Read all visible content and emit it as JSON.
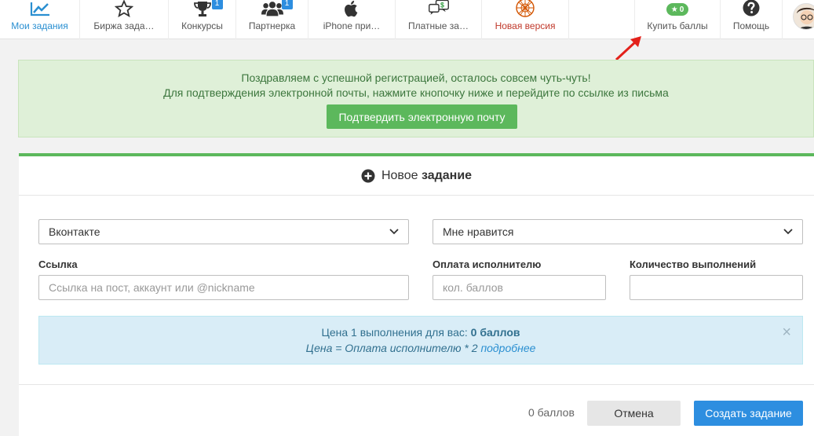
{
  "nav": {
    "items": [
      {
        "label": "Мои задания",
        "icon": "chart-line-icon"
      },
      {
        "label": "Биржа зада…",
        "icon": "star-icon"
      },
      {
        "label": "Конкурсы",
        "icon": "trophy-icon",
        "badge": "1"
      },
      {
        "label": "Партнерка",
        "icon": "users-icon",
        "badge": "1"
      },
      {
        "label": "iPhone при…",
        "icon": "apple-icon"
      },
      {
        "label": "Платные за…",
        "icon": "money-chat-icon"
      },
      {
        "label": "Новая версия",
        "icon": "globe-icon"
      },
      {
        "label": "Купить баллы",
        "icon": "star-pill-icon",
        "points": "0"
      },
      {
        "label": "Помощь",
        "icon": "help-icon"
      }
    ]
  },
  "success_alert": {
    "line1": "Поздравляем с успешной регистрацией, осталось совсем чуть-чуть!",
    "line2": "Для подтверждения электронной почты, нажмите кнопочку ниже и перейдите по ссылке из письма",
    "button": "Подтвердить электронную почту"
  },
  "form": {
    "title_prefix": "Новое",
    "title_bold": "задание",
    "network_select": "Вконтакте",
    "action_select": "Мне нравится",
    "link_label": "Ссылка",
    "link_placeholder": "Ссылка на пост, аккаунт или @nickname",
    "pay_label": "Оплата исполнителю",
    "pay_placeholder": "кол. баллов",
    "count_label": "Количество выполнений",
    "count_placeholder": ""
  },
  "info_alert": {
    "line1_prefix": "Цена 1 выполнения для вас:",
    "line1_value": "0 баллов",
    "line2_prefix": "Цена = Оплата исполнителю * 2",
    "line2_link": "подробнее"
  },
  "footer": {
    "total": "0 баллов",
    "cancel": "Отмена",
    "create": "Создать задание"
  },
  "colors": {
    "accent": "#2d8ee0",
    "success": "#5cb85c",
    "highlight": "#c0392b"
  }
}
